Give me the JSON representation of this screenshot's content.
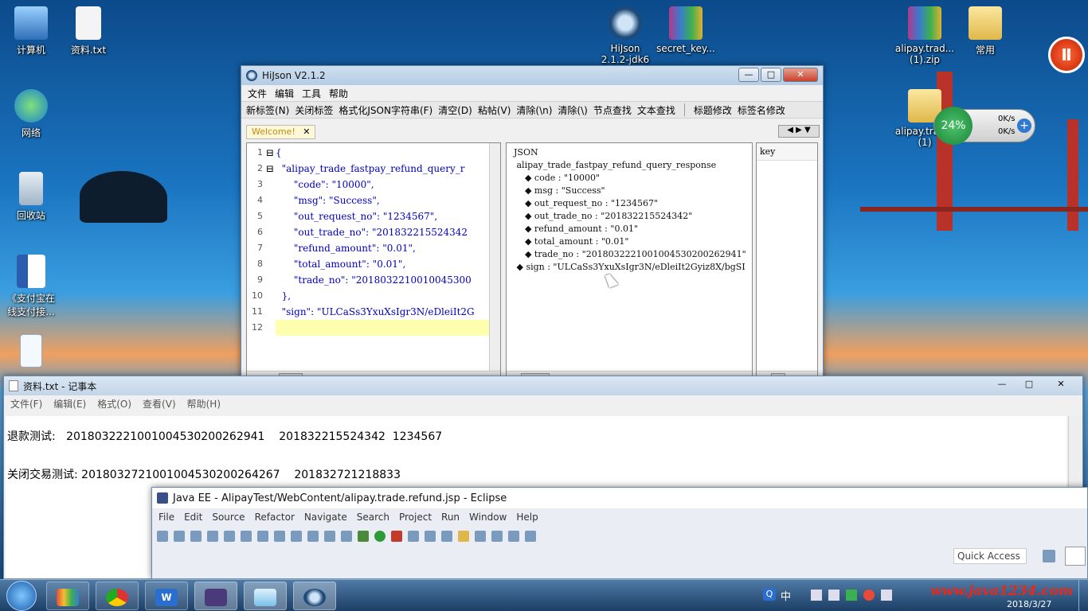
{
  "desktop": {
    "icons": [
      {
        "label": "计算机"
      },
      {
        "label": "资料.txt"
      },
      {
        "label": "网络"
      },
      {
        "label": "回收站"
      },
      {
        "label": "《支付宝在",
        "label2": "线支付接..."
      },
      {
        "label": "HiJson",
        "label2": "2.1.2-jdk6"
      },
      {
        "label": "secret_key..."
      },
      {
        "label": "alipay.trad...",
        "label2": "(1).zip"
      },
      {
        "label": "常用"
      },
      {
        "label": "alipay.trad...",
        "label2": "(1)"
      }
    ],
    "net_widget": {
      "percent": "24%",
      "up": "0K/s",
      "down": "0K/s"
    }
  },
  "hijson": {
    "title": "HiJson V2.1.2",
    "menu": [
      "文件",
      "编辑",
      "工具",
      "帮助"
    ],
    "toolbar": [
      "新标签(N)",
      "关闭标签",
      "格式化JSON字符串(F)",
      "清空(D)",
      "粘帖(V)",
      "清除(\\n)",
      "清除(\\)",
      "节点查找",
      "文本查找",
      "标题修改",
      "标签名修改"
    ],
    "tab": "Welcome!",
    "code_lines": [
      {
        "n": "1",
        "t": "{"
      },
      {
        "n": "2",
        "t": "  \"alipay_trade_fastpay_refund_query_r"
      },
      {
        "n": "3",
        "t": "      \"code\": \"10000\","
      },
      {
        "n": "4",
        "t": "      \"msg\": \"Success\","
      },
      {
        "n": "5",
        "t": "      \"out_request_no\": \"1234567\","
      },
      {
        "n": "6",
        "t": "      \"out_trade_no\": \"201832215524342"
      },
      {
        "n": "7",
        "t": "      \"refund_amount\": \"0.01\","
      },
      {
        "n": "8",
        "t": "      \"total_amount\": \"0.01\","
      },
      {
        "n": "9",
        "t": "      \"trade_no\": \"2018032210010045300"
      },
      {
        "n": "10",
        "t": "  },"
      },
      {
        "n": "11",
        "t": "  \"sign\": \"ULCaSs3YxuXsIgr3N/eDleiIt2G"
      },
      {
        "n": "12",
        "t": ""
      }
    ],
    "tree_lines": [
      "  JSON",
      "   alipay_trade_fastpay_refund_query_response",
      "      ◆ code : \"10000\"",
      "      ◆ msg : \"Success\"",
      "      ◆ out_request_no : \"1234567\"",
      "      ◆ out_trade_no : \"201832215524342\"",
      "      ◆ refund_amount : \"0.01\"",
      "      ◆ total_amount : \"0.01\"",
      "      ◆ trade_no : \"2018032221001004530200262941\"",
      "   ◆ sign : \"ULCaSs3YxuXsIgr3N/eDleiIt2Gyiz8X/bgSI"
    ],
    "key_header": "key"
  },
  "notepad": {
    "title": "资料.txt - 记事本",
    "menu": [
      "文件(F)",
      "编辑(E)",
      "格式(O)",
      "查看(V)",
      "帮助(H)"
    ],
    "lines": [
      "退款测试:   2018032221001004530200262941    201832215524342  1234567",
      "",
      "关闭交易测试: 2018032721001004530200264267    201832721218833"
    ]
  },
  "eclipse": {
    "title": "Java EE - AlipayTest/WebContent/alipay.trade.refund.jsp - Eclipse",
    "menu": [
      "File",
      "Edit",
      "Source",
      "Refactor",
      "Navigate",
      "Search",
      "Project",
      "Run",
      "Window",
      "Help"
    ],
    "quick_access": "Quick Access"
  },
  "taskbar": {
    "tray_lang": "中",
    "watermark": "www.java1234.com",
    "date": "2018/3/27"
  }
}
